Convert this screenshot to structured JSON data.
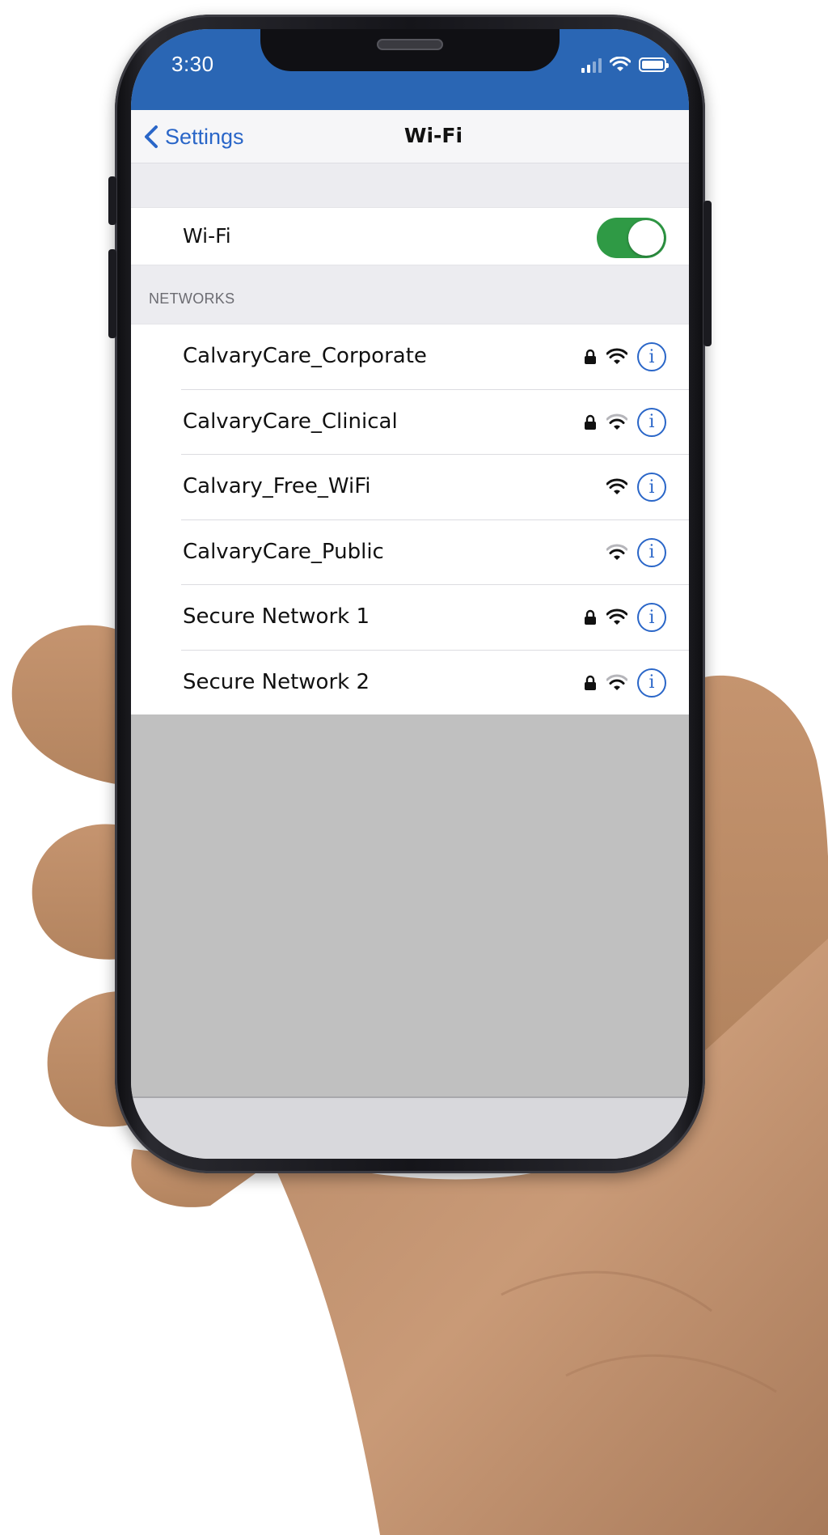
{
  "status_bar": {
    "time": "3:30",
    "background_color": "#2a66b4",
    "icons": [
      "signal-icon",
      "wifi-icon",
      "battery-icon"
    ]
  },
  "nav": {
    "back_label": "Settings",
    "title": "Wi-Fi",
    "accent_color": "#2a66c8"
  },
  "wifi_toggle": {
    "label": "Wi-Fi",
    "enabled": true,
    "on_color": "#2f9a45"
  },
  "networks_section": {
    "header": "NETWORKS",
    "items": [
      {
        "name": "CalvaryCare_Corporate",
        "secured": true,
        "signal": "strong"
      },
      {
        "name": "CalvaryCare_Clinical",
        "secured": true,
        "signal": "medium"
      },
      {
        "name": "Calvary_Free_WiFi",
        "secured": false,
        "signal": "strong"
      },
      {
        "name": "CalvaryCare_Public",
        "secured": false,
        "signal": "medium"
      },
      {
        "name": "Secure Network 1",
        "secured": true,
        "signal": "strong"
      },
      {
        "name": "Secure Network 2",
        "secured": true,
        "signal": "medium"
      }
    ],
    "info_glyph": "i"
  }
}
